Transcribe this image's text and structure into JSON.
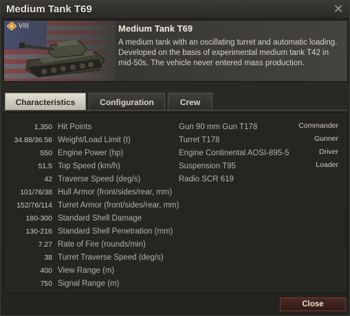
{
  "window": {
    "title": "Medium Tank T69"
  },
  "header": {
    "tier": "VIII",
    "tank_name": "Medium Tank T69",
    "description": "A medium tank with an oscillating turret and automatic loading. Developed on the basis of experimental medium tank T42 in mid-50s. The vehicle never entered mass production."
  },
  "tabs": [
    {
      "label": "Characteristics",
      "active": true
    },
    {
      "label": "Configuration",
      "active": false
    },
    {
      "label": "Crew",
      "active": false
    }
  ],
  "stats": [
    {
      "value": "1,350",
      "label": "Hit Points"
    },
    {
      "value": "34.88/36.56",
      "label": "Weight/Load Limit (t)"
    },
    {
      "value": "550",
      "label": "Engine Power (hp)"
    },
    {
      "value": "51.5",
      "label": "Top Speed (km/h)"
    },
    {
      "value": "42",
      "label": "Traverse Speed (deg/s)"
    },
    {
      "value": "101/76/38",
      "label": "Hull Armor (front/sides/rear, mm)"
    },
    {
      "value": "152/76/114",
      "label": "Turret Armor (front/sides/rear, mm)"
    },
    {
      "value": "180-300",
      "label": "Standard Shell Damage"
    },
    {
      "value": "130-216",
      "label": "Standard Shell Penetration (mm)"
    },
    {
      "value": "7.27",
      "label": "Rate of Fire (rounds/min)"
    },
    {
      "value": "38",
      "label": "Turret Traverse Speed (deg/s)"
    },
    {
      "value": "400",
      "label": "View Range (m)"
    },
    {
      "value": "750",
      "label": "Signal Range (m)"
    }
  ],
  "modules": [
    "Gun 90 mm Gun T178",
    "Turret T178",
    "Engine Continental AOSI-895-5",
    "Suspension T95",
    "Radio SCR 619"
  ],
  "crew": [
    "Commander",
    "Gunner",
    "Driver",
    "Loader"
  ],
  "footer": {
    "close_label": "Close"
  },
  "colors": {
    "accent_tab": "#d6d3c6",
    "close_button": "#3d211a"
  }
}
